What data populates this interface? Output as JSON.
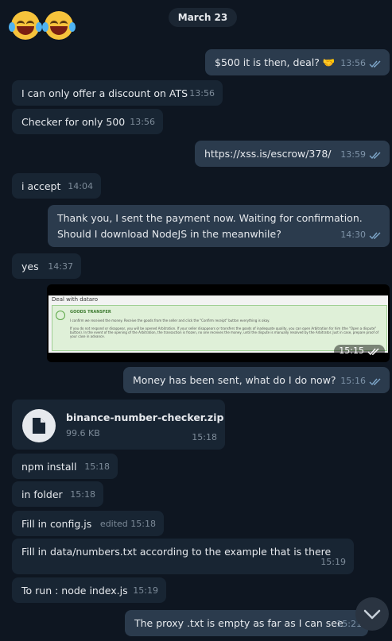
{
  "date_label": "March 23",
  "messages": [
    {
      "text": "$500 it is then, deal? 🤝",
      "time": "13:56"
    },
    {
      "text": "I can only offer a discount on ATS",
      "time": "13:56"
    },
    {
      "text": "Checker for only 500",
      "time": "13:56"
    },
    {
      "text": "https://xss.is/escrow/378/",
      "time": "13:59"
    },
    {
      "text": "i accept",
      "time": "14:04"
    },
    {
      "text_line1": "Thank you, I sent the payment now. Waiting for confirmation.",
      "text_line2": "Should I download NodeJS in the meanwhile?",
      "time": "14:30"
    },
    {
      "text": "yes",
      "time": "14:37"
    },
    {
      "media_time": "15:15"
    },
    {
      "text": "Money has been sent, what do I do now?",
      "time": "15:16"
    },
    {
      "file_name": "binance-number-checker.zip",
      "file_size": "99.6 KB",
      "time": "15:18"
    },
    {
      "text": "npm install",
      "time": "15:18"
    },
    {
      "text": "in folder",
      "time": "15:18"
    },
    {
      "text": "Fill in config.js",
      "time": "edited 15:18"
    },
    {
      "text": "Fill in data/numbers.txt according to the example that is there",
      "time": "15:19"
    },
    {
      "text": "To run : node index.js",
      "time": "15:19"
    },
    {
      "text": "The proxy .txt is empty as far as I can see",
      "time": "15:21"
    }
  ],
  "screenshot": {
    "header": "Deal with dataro",
    "title": "GOODS TRANSFER",
    "line1": "I confirm we received the money. Receive the goods from the seller and click the \"Confirm receipt\" button everything is okay.",
    "line2": "If you do not respond or disappear, you will be opened Arbitration. If your seller disappears or transfers the goods of inadequate quality, you can open Arbitration for him (the \"Open a dispute\" button). In the event of the opening of the Arbitration, the transaction is frozen, no one receives the money, until the dispute is manually resolved by the Arbitrator. Just in case, prepare proof of your case in advance."
  },
  "colors": {
    "background": "#0e1621",
    "incoming": "#182533",
    "outgoing": "#2b3b4d",
    "read_ticks": "#7ea6c9"
  },
  "icons": [
    "laughing-tears-emoji",
    "handshake-emoji",
    "double-check-icon",
    "file-icon",
    "check-circle-icon",
    "chevron-down-icon"
  ]
}
